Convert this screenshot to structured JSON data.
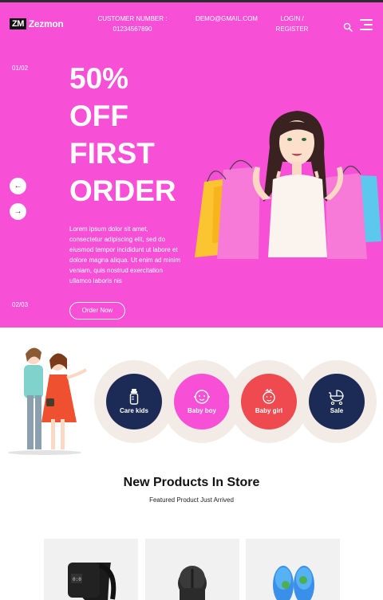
{
  "header": {
    "logo_badge": "ZM",
    "logo_text": "Zezmon",
    "customer_number_label": "CUSTOMER NUMBER :",
    "customer_number": "01234567890",
    "email": "DEMO@GMAIL.COM",
    "login_label": "LOGIN /",
    "register_label": "REGISTER"
  },
  "hero": {
    "slide_current": "01/02",
    "slide_next": "02/03",
    "prev_arrow": "←",
    "next_arrow": "→",
    "title_lines": [
      "50%",
      "OFF",
      "FIRST",
      "ORDER"
    ],
    "description": "Lorem ipsum dolor sit amet, consectetur adipiscing elit, sed do eiusmod tempor incididunt ut labore et dolore magna aliqua. Ut enim ad minim veniam, quis nostrud exercitation ullamco laboris nis",
    "cta_label": "Order Now"
  },
  "categories": [
    {
      "label": "Care kids",
      "color": "#1c2b55",
      "icon": "baby-bottle-icon"
    },
    {
      "label": "Baby boy",
      "color": "#f74fd6",
      "icon": "baby-face-icon"
    },
    {
      "label": "Baby girl",
      "color": "#ef4a50",
      "icon": "baby-girl-icon"
    },
    {
      "label": "Sale",
      "color": "#1c2b55",
      "icon": "stroller-icon"
    }
  ],
  "section": {
    "title": "New Products In Store",
    "subtitle": "Featured Product Just Arrived"
  },
  "products": [
    {
      "icon": "fitness-band-icon"
    },
    {
      "icon": "thermos-icon"
    },
    {
      "icon": "slippers-icon"
    }
  ],
  "colors": {
    "hero_bg": "#f74fd6",
    "navy": "#1c2b55",
    "pink": "#f74fd6",
    "red": "#ef4a50",
    "ring": "#f3ece6"
  }
}
